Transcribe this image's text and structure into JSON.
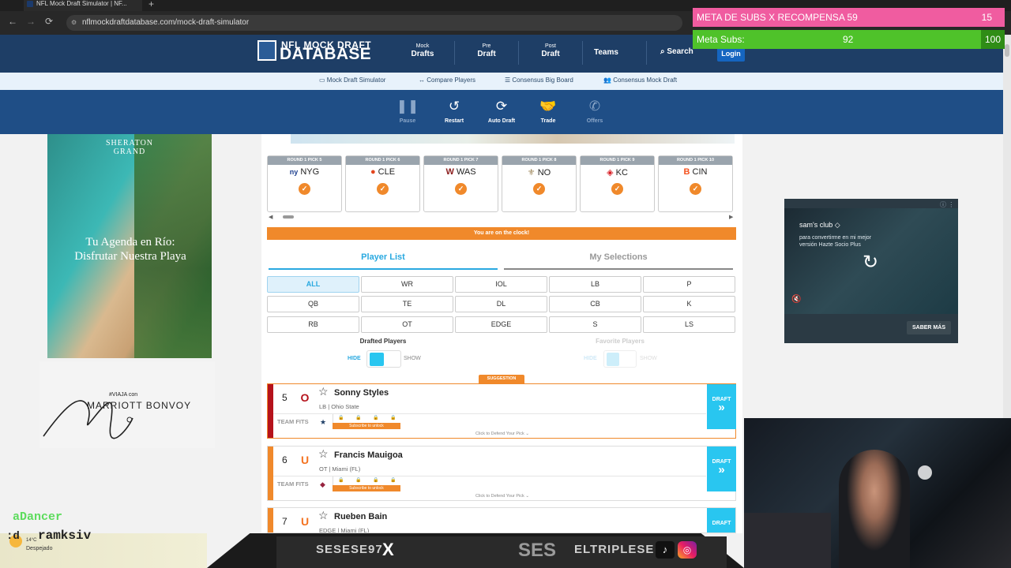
{
  "browser": {
    "tab_title": "NFL Mock Draft Simulator | NF...",
    "new_tab": "+",
    "url": "nflmockdraftdatabase.com/mock-draft-simulator",
    "back": "←",
    "forward": "→",
    "reload": "⟳"
  },
  "header": {
    "logo_line1": "NFL MOCK DRAFT",
    "logo_line2": "DATABASE",
    "nav": [
      {
        "small": "Mock",
        "big": "Drafts"
      },
      {
        "small": "Pre",
        "big": "Draft"
      },
      {
        "small": "Post",
        "big": "Draft"
      }
    ],
    "teams": "Teams",
    "search": "Search",
    "login": "Login"
  },
  "subnav": [
    {
      "icon": "monitor-icon",
      "label": "Mock Draft Simulator"
    },
    {
      "icon": "compare-icon",
      "label": "Compare Players"
    },
    {
      "icon": "list-icon",
      "label": "Consensus Big Board"
    },
    {
      "icon": "users-icon",
      "label": "Consensus Mock Draft"
    }
  ],
  "toolbar": [
    {
      "icon": "pause-icon",
      "glyph": "❚❚",
      "label": "Pause"
    },
    {
      "icon": "restart-icon",
      "glyph": "↺",
      "label": "Restart"
    },
    {
      "icon": "auto-draft-icon",
      "glyph": "⟳",
      "label": "Auto Draft"
    },
    {
      "icon": "trade-icon",
      "glyph": "🤝",
      "label": "Trade"
    },
    {
      "icon": "offers-icon",
      "glyph": "✆",
      "label": "Offers"
    }
  ],
  "left_ad": {
    "brand": "SHERATON\nGRAND",
    "tagline": "Tu Agenda en Río:\nDisfrutar Nuestra Playa",
    "bonvoy_small": "#VIAJA con",
    "bonvoy": "MARRIOTT BONVOY"
  },
  "picks": [
    {
      "round": "ROUND 1 PICK 5",
      "team": "NYG",
      "logo": "ny"
    },
    {
      "round": "ROUND 1 PICK 6",
      "team": "CLE",
      "logo": "●"
    },
    {
      "round": "ROUND 1 PICK 7",
      "team": "WAS",
      "logo": "W"
    },
    {
      "round": "ROUND 1 PICK 8",
      "team": "NO",
      "logo": "⚜"
    },
    {
      "round": "ROUND 1 PICK 9",
      "team": "KC",
      "logo": "◈"
    },
    {
      "round": "ROUND 1 PICK 10",
      "team": "CIN",
      "logo": "B"
    }
  ],
  "check_glyph": "✓",
  "clock_text": "You are on the clock!",
  "tabs": {
    "player_list": "Player List",
    "my_selections": "My Selections"
  },
  "positions": [
    [
      "ALL",
      "WR",
      "IOL",
      "LB",
      "P"
    ],
    [
      "QB",
      "TE",
      "DL",
      "CB",
      "K"
    ],
    [
      "RB",
      "OT",
      "EDGE",
      "S",
      "LS"
    ]
  ],
  "filters": {
    "drafted_players": "Drafted Players",
    "favorite_players": "Favorite Players",
    "hide": "HIDE",
    "show": "SHOW"
  },
  "suggestion_label": "SUGGESTION",
  "players": [
    {
      "rank": "5",
      "name": "Sonny Styles",
      "info": "LB | Ohio State",
      "bar_color": "#b5121b",
      "logo": "O",
      "logo_color": "#b5121b",
      "team_fit_logo": "★"
    },
    {
      "rank": "6",
      "name": "Francis Mauigoa",
      "info": "OT | Miami (FL)",
      "bar_color": "#f0892b",
      "logo": "U",
      "logo_color": "#f47321",
      "team_fit_logo": "◆"
    },
    {
      "rank": "7",
      "name": "Rueben Bain",
      "info": "EDGE | Miami (FL)",
      "bar_color": "#f0892b",
      "logo": "U",
      "logo_color": "#f47321",
      "team_fit_logo": ""
    }
  ],
  "player_labels": {
    "team_fits": "TEAM FITS",
    "subscribe": "Subscribe to unlock",
    "defend": "Click to Defend Your Pick ⌄",
    "draft": "DRAFT",
    "draft_arrow": "»",
    "lock": "🔒"
  },
  "right_ad": {
    "brand": "sam's club ◇",
    "copy": "para convertirme en mi mejor versión Hazte Socio Plus",
    "cta": "SABER MÁS",
    "info": "ⓘ ⋮",
    "replay": "↻",
    "mute": "🔇"
  },
  "overlay": {
    "subs_goal_label": "META DE SUBS X RECOMPENSA",
    "subs_goal_value": "59",
    "subs_goal_right": "15",
    "meta_subs_label": "Meta Subs:",
    "meta_subs_value": "92",
    "meta_subs_target": "100",
    "handle1": "SESESE97",
    "x_logo": "X",
    "handle_big": "SES",
    "handle2": "ELTRIPLESE",
    "tiktok": "♪",
    "insta": "◎",
    "chat_user1": "aDancer",
    "chat_user2_prefix": ":d",
    "chat_user2": "ramksiv",
    "temp": "14°C",
    "weather": "Despejado"
  },
  "colors": {
    "header": "#1e3e66",
    "accent_blue": "#29a9e0",
    "accent_orange": "#f0892b",
    "draft_button": "#29c6f0"
  }
}
